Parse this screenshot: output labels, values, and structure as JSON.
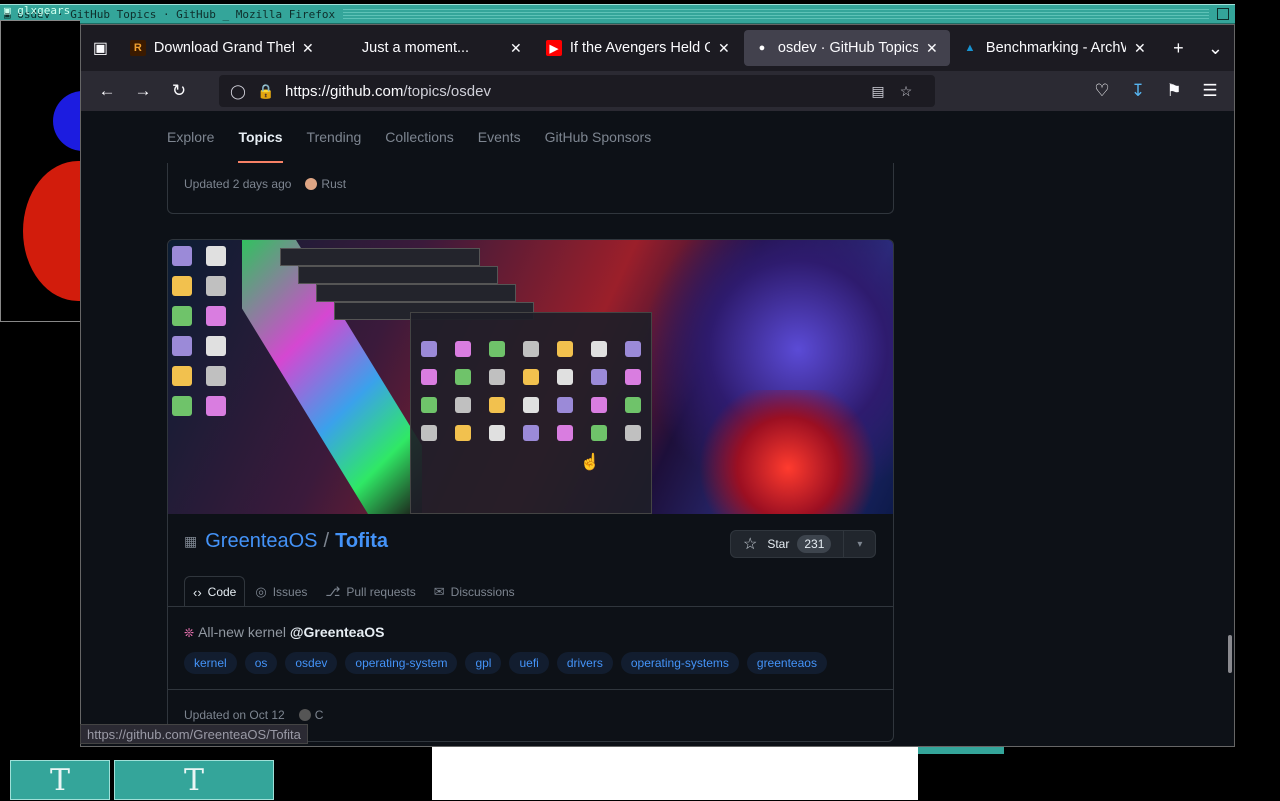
{
  "desktop": {
    "wm_title": "▣ osdev · GitHub Topics · GitHub _ Mozilla Firefox",
    "mini_title": "▣ glxgears",
    "taskbar_glyph": "T"
  },
  "browser": {
    "tabs": [
      {
        "label": "Download Grand Theft",
        "favicon": "R",
        "fav_color": "#f0a030",
        "fav_bg": "#3a1a00",
        "active": false
      },
      {
        "label": "Just a moment...",
        "favicon": "",
        "fav_color": "#fbfbfe",
        "fav_bg": "transparent",
        "active": false
      },
      {
        "label": "If the Avengers Held O",
        "favicon": "▶",
        "fav_color": "#ffffff",
        "fav_bg": "#ff0000",
        "active": false
      },
      {
        "label": "osdev · GitHub Topics",
        "favicon": "●",
        "fav_color": "#ffffff",
        "fav_bg": "transparent",
        "active": true
      },
      {
        "label": "Benchmarking - ArchW",
        "favicon": "▲",
        "fav_color": "#1793d1",
        "fav_bg": "transparent",
        "active": false
      }
    ],
    "url_host": "https://github.com",
    "url_path": "/topics/osdev",
    "status_url": "https://github.com/GreenteaOS/Tofita"
  },
  "github": {
    "subnav": [
      "Explore",
      "Topics",
      "Trending",
      "Collections",
      "Events",
      "GitHub Sponsors"
    ],
    "active_subnav": "Topics",
    "prev_card": {
      "updated": "Updated 2 days ago",
      "language": "Rust",
      "lang_color": "#dea584"
    },
    "repo": {
      "owner": "GreenteaOS",
      "name": "Tofita",
      "star_label": "Star",
      "star_count": "231",
      "tabs": [
        "Code",
        "Issues",
        "Pull requests",
        "Discussions"
      ],
      "description_prefix": "All-new kernel ",
      "description_owner": "@GreenteaOS",
      "topics": [
        "kernel",
        "os",
        "osdev",
        "operating-system",
        "gpl",
        "uefi",
        "drivers",
        "operating-systems",
        "greenteaos"
      ],
      "updated": "Updated on Oct 12",
      "language": "C",
      "lang_color": "#555555"
    }
  }
}
